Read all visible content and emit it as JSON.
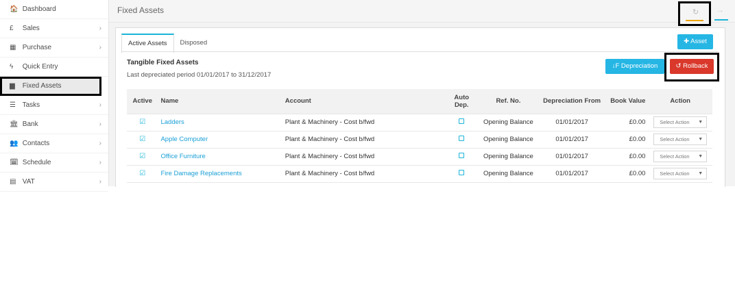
{
  "sidebar": {
    "items": [
      {
        "icon": "home-icon",
        "glyph": "🏠",
        "label": "Dashboard",
        "chevron": false,
        "active": false
      },
      {
        "icon": "pound-icon",
        "glyph": "£",
        "label": "Sales",
        "chevron": true,
        "active": false
      },
      {
        "icon": "purchase-icon",
        "glyph": "▦",
        "label": "Purchase",
        "chevron": true,
        "active": false
      },
      {
        "icon": "bolt-icon",
        "glyph": "ϟ",
        "label": "Quick Entry",
        "chevron": false,
        "active": false
      },
      {
        "icon": "building-icon",
        "glyph": "▆",
        "label": "Fixed Assets",
        "chevron": false,
        "active": true
      },
      {
        "icon": "tasks-icon",
        "glyph": "☰",
        "label": "Tasks",
        "chevron": true,
        "active": false
      },
      {
        "icon": "bank-icon",
        "glyph": "🏛",
        "label": "Bank",
        "chevron": true,
        "active": false
      },
      {
        "icon": "users-icon",
        "glyph": "👥",
        "label": "Contacts",
        "chevron": true,
        "active": false
      },
      {
        "icon": "calendar-icon",
        "glyph": "🗓",
        "label": "Schedule",
        "chevron": true,
        "active": false
      },
      {
        "icon": "calculator-icon",
        "glyph": "▤",
        "label": "VAT",
        "chevron": true,
        "active": false
      }
    ],
    "chevron_glyph": "›"
  },
  "header": {
    "title": "Fixed Assets",
    "refresh_glyph": "↻",
    "arrow_glyph": "→"
  },
  "tabs": [
    {
      "label": "Active Assets"
    },
    {
      "label": "Disposed"
    }
  ],
  "buttons": {
    "asset": "✚ Asset",
    "depreciation": "↓F Depreciation",
    "rollback": "↺ Rollback"
  },
  "section": {
    "title": "Tangible Fixed Assets",
    "subtitle": "Last depreciated period 01/01/2017 to 31/12/2017"
  },
  "table": {
    "headers": {
      "active": "Active",
      "name": "Name",
      "account": "Account",
      "auto_dep": "Auto Dep.",
      "ref": "Ref. No.",
      "dep_from": "Depreciation From",
      "book_value": "Book Value",
      "action": "Action"
    },
    "rows": [
      {
        "name": "Ladders",
        "account": "Plant & Machinery - Cost b/fwd",
        "ref": "Opening Balance",
        "dep_from": "01/01/2017",
        "book_value": "£0.00",
        "action": "Select Action"
      },
      {
        "name": "Apple Computer",
        "account": "Plant & Machinery - Cost b/fwd",
        "ref": "Opening Balance",
        "dep_from": "01/01/2017",
        "book_value": "£0.00",
        "action": "Select Action"
      },
      {
        "name": "Office Furniture",
        "account": "Plant & Machinery - Cost b/fwd",
        "ref": "Opening Balance",
        "dep_from": "01/01/2017",
        "book_value": "£0.00",
        "action": "Select Action"
      },
      {
        "name": "Fire Damage Replacements",
        "account": "Plant & Machinery - Cost b/fwd",
        "ref": "Opening Balance",
        "dep_from": "01/01/2017",
        "book_value": "£0.00",
        "action": "Select Action"
      }
    ],
    "check_glyph": "☑",
    "caret_glyph": "▼"
  },
  "colors": {
    "accent": "#25b6e4",
    "danger": "#d9382b",
    "link": "#1a9fd6"
  }
}
